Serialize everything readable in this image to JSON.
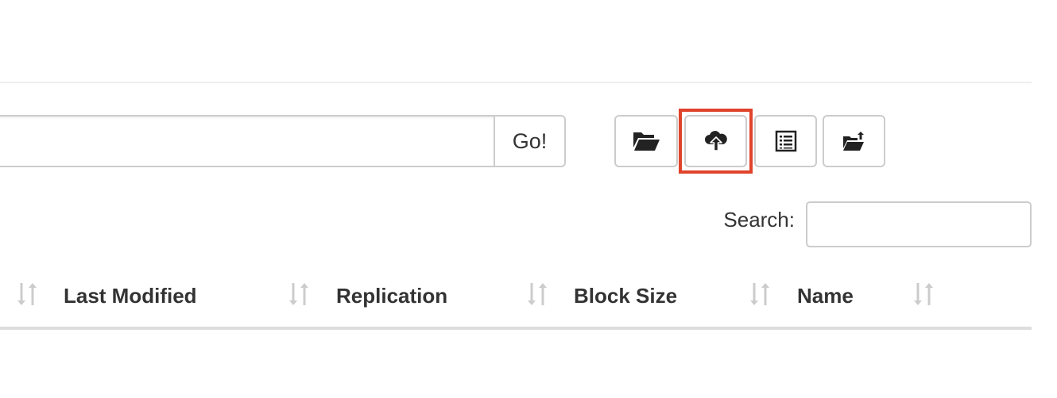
{
  "path_bar": {
    "value": "",
    "go_label": "Go!"
  },
  "toolbar": {
    "buttons": [
      {
        "icon": "folder-open-icon"
      },
      {
        "icon": "cloud-upload-icon"
      },
      {
        "icon": "list-alt-icon"
      },
      {
        "icon": "folder-paste-icon"
      }
    ],
    "highlighted": "cloud-upload-button"
  },
  "search": {
    "label": "Search:",
    "value": ""
  },
  "table": {
    "columns": [
      "Last Modified",
      "Replication",
      "Block Size",
      "Name"
    ]
  },
  "colors": {
    "highlight": "#e0432b",
    "border": "#cccccc",
    "sort_icon": "#cccccc"
  }
}
